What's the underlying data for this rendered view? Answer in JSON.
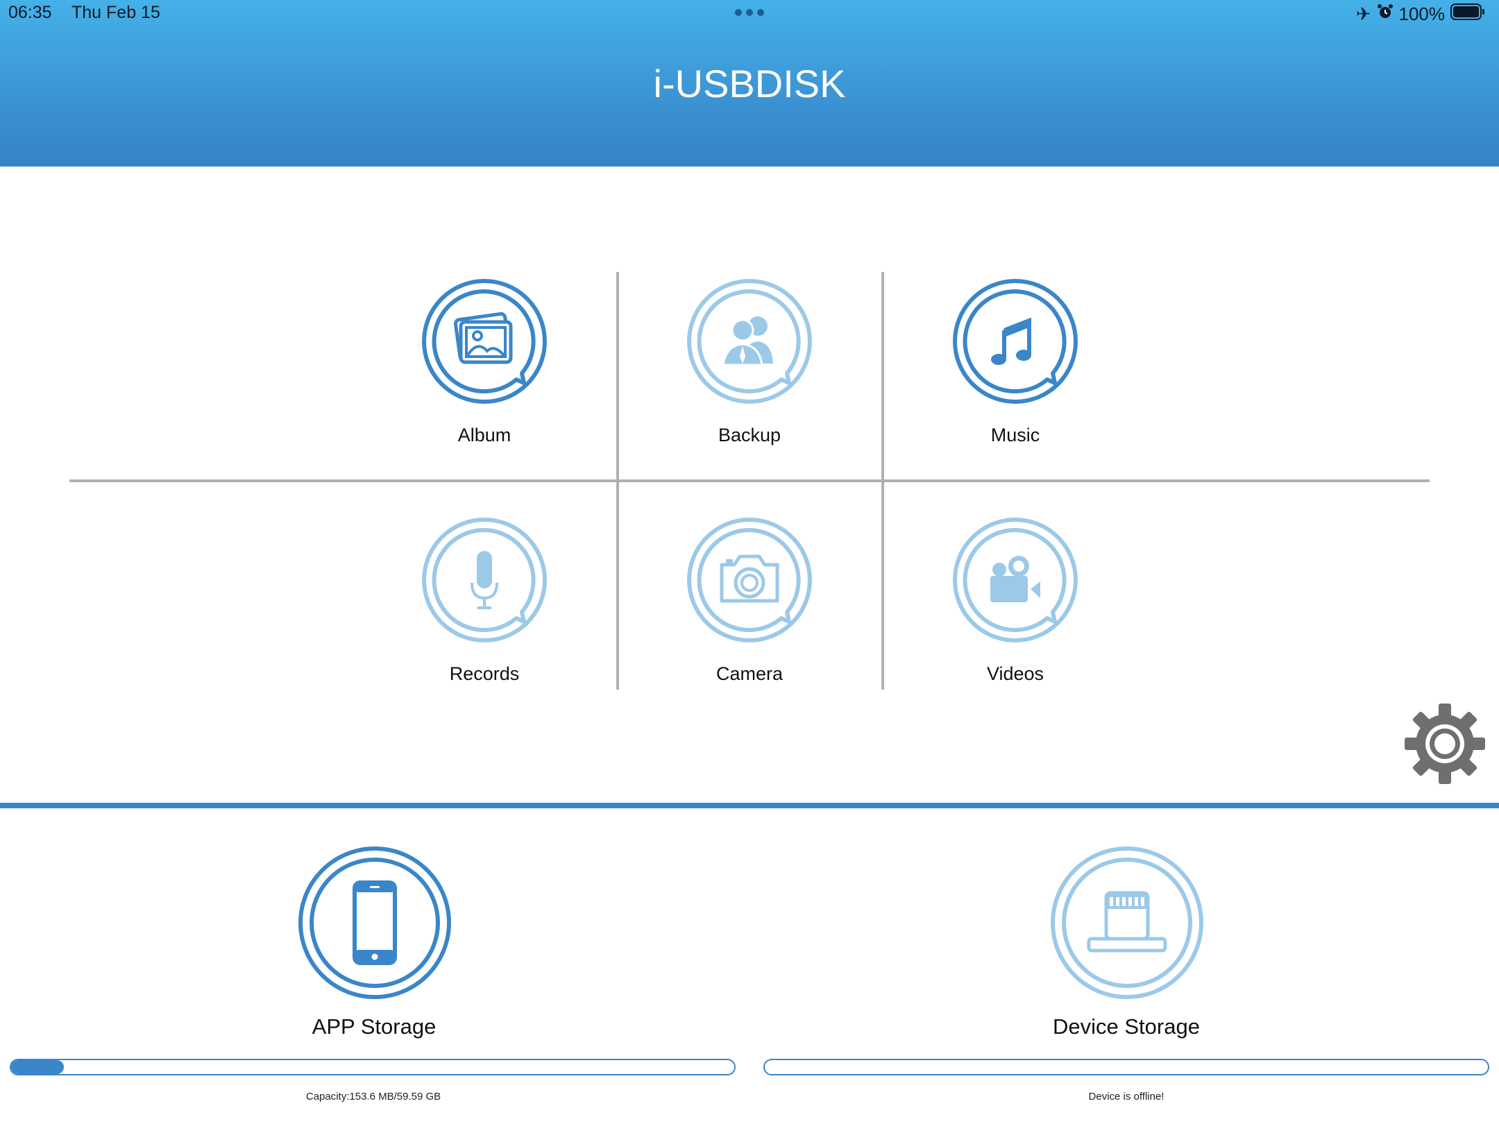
{
  "status_bar": {
    "time": "06:35",
    "date": "Thu Feb 15",
    "battery": "100%"
  },
  "app": {
    "title": "i-USBDISK"
  },
  "menu": [
    {
      "label": "Album",
      "icon": "album-icon"
    },
    {
      "label": "Backup",
      "icon": "backup-icon"
    },
    {
      "label": "Music",
      "icon": "music-icon"
    },
    {
      "label": "Records",
      "icon": "microphone-icon"
    },
    {
      "label": "Camera",
      "icon": "camera-icon"
    },
    {
      "label": "Videos",
      "icon": "video-camera-icon"
    }
  ],
  "storage": {
    "app": {
      "label": "APP Storage",
      "capacity": "Capacity:153.6 MB/59.59 GB",
      "used_fraction": 0.0025
    },
    "device": {
      "label": "Device Storage",
      "capacity": "Device is offline!",
      "used_fraction": 0
    }
  },
  "colors": {
    "header": "#3a8ed0",
    "accent": "#3a86c9",
    "inactive": "#9cc9e8"
  }
}
